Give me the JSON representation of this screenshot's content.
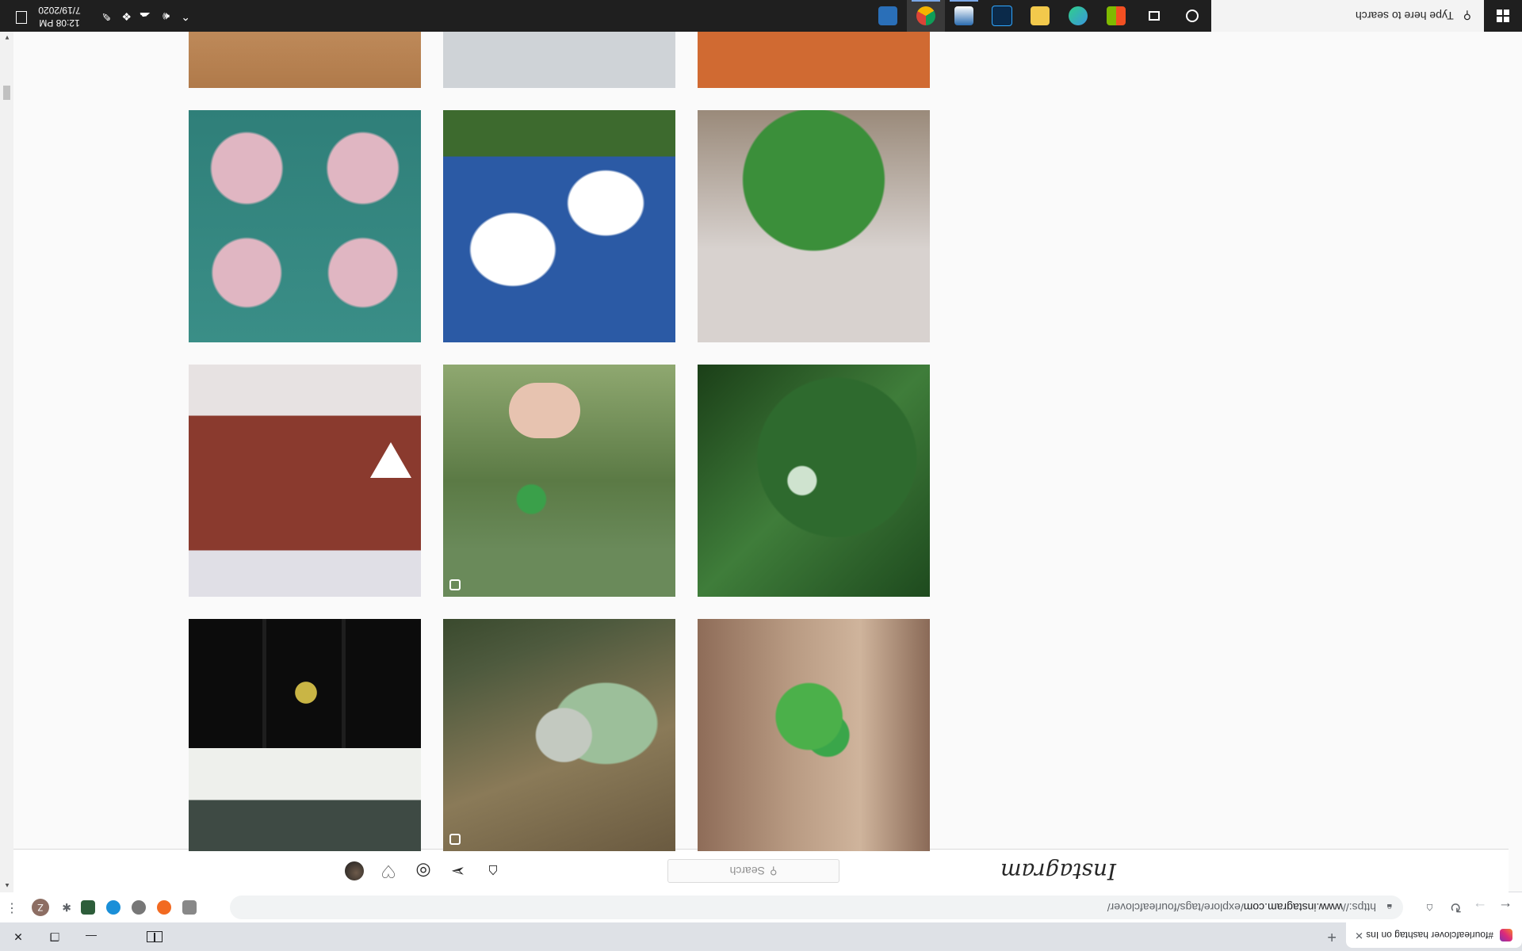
{
  "browser": {
    "tab_title": "#fourleafclover hashtag on Insta",
    "tab_close": "✕",
    "new_tab": "+",
    "url_scheme": "https://",
    "url_host": "www.instagram.com",
    "url_path": "/explore/tags/fourleafclover/",
    "profile_initial": "Z",
    "icons": [
      "back-icon",
      "forward-icon",
      "reload-icon",
      "bookmark-icon",
      "lock-icon",
      "menu-icon"
    ]
  },
  "instagram": {
    "logo": "Instagram",
    "search_placeholder": "Search",
    "nav_icons": [
      "home-icon",
      "direct-icon",
      "explore-icon",
      "heart-icon",
      "avatar"
    ]
  },
  "grid": {
    "tiles": [
      {
        "desc": "clover on wood"
      },
      {
        "desc": "bottles in leaves"
      },
      {
        "desc": "black shirts"
      },
      {
        "desc": "clover with droplets"
      },
      {
        "desc": "hand holding clover"
      },
      {
        "desc": "red car emblem"
      },
      {
        "desc": "clover in jar"
      },
      {
        "desc": "sky and clouds"
      },
      {
        "desc": "pink headscarf collage"
      },
      {
        "desc": "clover on wood partial"
      },
      {
        "desc": "partial tile"
      },
      {
        "desc": "blue object partial"
      }
    ]
  },
  "taskbar": {
    "search_placeholder": "Type here to search",
    "time": "12:08 PM",
    "date": "7/19/2020"
  }
}
